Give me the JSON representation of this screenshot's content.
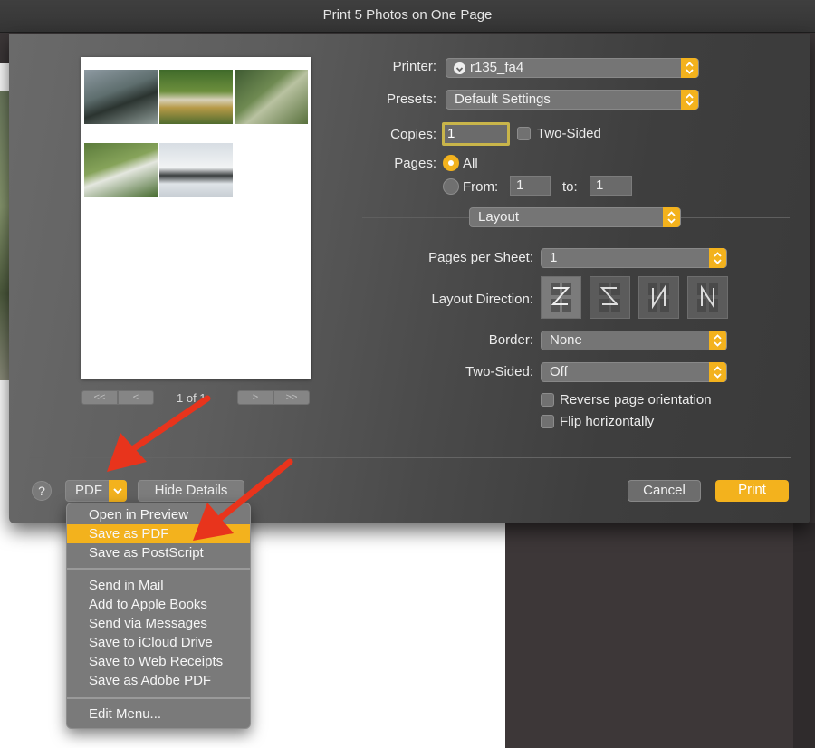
{
  "window": {
    "title": "Print 5 Photos on One Page"
  },
  "preview": {
    "thumbnails": [
      "heron-on-rock-photo",
      "pond-scene-photo",
      "heron-portrait-photo",
      "heron-grass-photo",
      "snow-pond-photo"
    ],
    "page_label": "1 of 1"
  },
  "pager": {
    "first": "<<",
    "prev": "<",
    "next": ">",
    "last": ">>"
  },
  "printer": {
    "label": "Printer:",
    "value": "r135_fa4"
  },
  "presets": {
    "label": "Presets:",
    "value": "Default Settings"
  },
  "copies": {
    "label": "Copies:",
    "value": "1",
    "two_sided_label": "Two-Sided"
  },
  "pages": {
    "label": "Pages:",
    "all_label": "All",
    "from_label": "From:",
    "from_value": "1",
    "to_label": "to:",
    "to_value": "1"
  },
  "section": {
    "value": "Layout"
  },
  "layout": {
    "pages_per_sheet_label": "Pages per Sheet:",
    "pages_per_sheet_value": "1",
    "direction_label": "Layout Direction:",
    "border_label": "Border:",
    "border_value": "None",
    "two_sided_label": "Two-Sided:",
    "two_sided_value": "Off",
    "reverse_label": "Reverse page orientation",
    "flip_label": "Flip horizontally"
  },
  "footer": {
    "help": "?",
    "pdf": "PDF",
    "hide_details": "Hide Details",
    "cancel": "Cancel",
    "print": "Print"
  },
  "pdf_menu": {
    "group1": [
      "Open in Preview",
      "Save as PDF",
      "Save as PostScript"
    ],
    "group2": [
      "Send in Mail",
      "Add to Apple Books",
      "Send via Messages",
      "Save to iCloud Drive",
      "Save to Web Receipts",
      "Save as Adobe PDF"
    ],
    "group3": [
      "Edit Menu..."
    ],
    "highlighted": "Save as PDF"
  },
  "colors": {
    "accent": "#f3b21d",
    "annotation_arrow": "#e8341c"
  }
}
